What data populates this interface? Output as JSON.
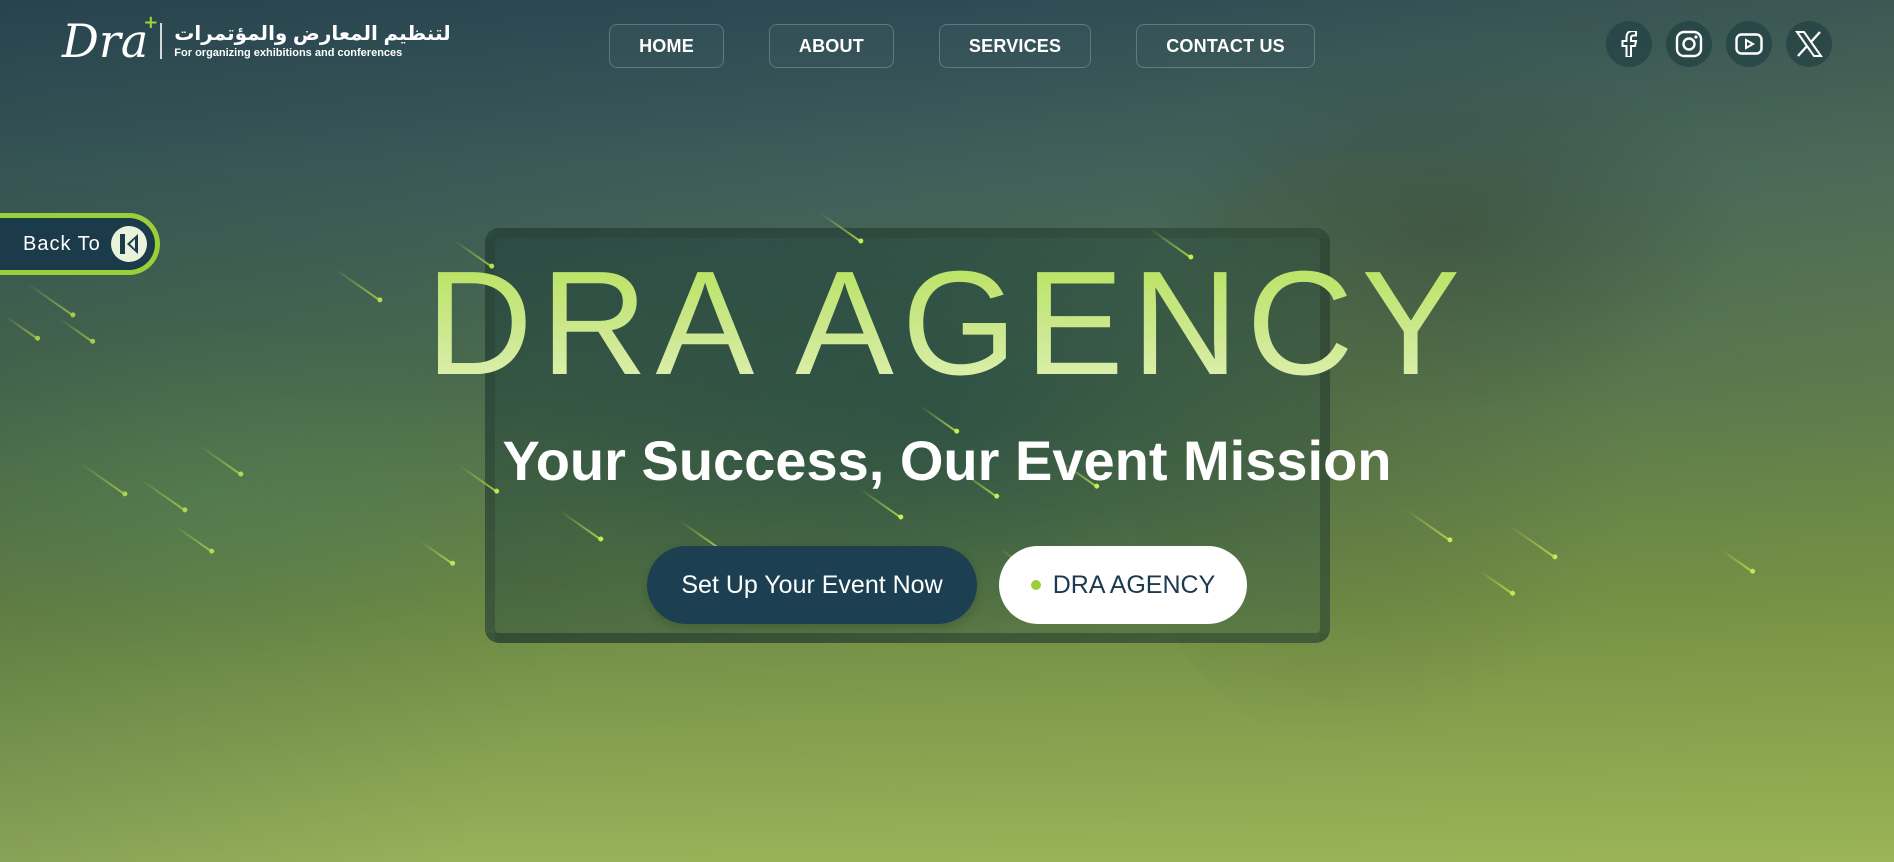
{
  "brand": {
    "mark": "Dra",
    "arabic_name": "لتنظيم المعارض والمؤتمرات",
    "tagline": "For organizing exhibitions and conferences",
    "accent": "#9bcf3a"
  },
  "nav": {
    "items": [
      {
        "label": "HOME"
      },
      {
        "label": "ABOUT"
      },
      {
        "label": "SERVICES"
      },
      {
        "label": "CONTACT US"
      }
    ]
  },
  "social": {
    "items": [
      {
        "icon": "facebook-icon"
      },
      {
        "icon": "instagram-icon"
      },
      {
        "icon": "youtube-icon"
      },
      {
        "icon": "x-icon"
      }
    ]
  },
  "back_tab": {
    "label": "Back To",
    "icon": "k-logo-icon"
  },
  "hero": {
    "title": "DRA AGENCY",
    "subtitle": "Your Success, Our Event Mission",
    "primary_cta": "Set Up Your Event Now",
    "secondary_cta": "DRA AGENCY"
  },
  "colors": {
    "dark_navy": "#1c3f52",
    "headline_green": "#b6e25a",
    "white": "#ffffff"
  }
}
